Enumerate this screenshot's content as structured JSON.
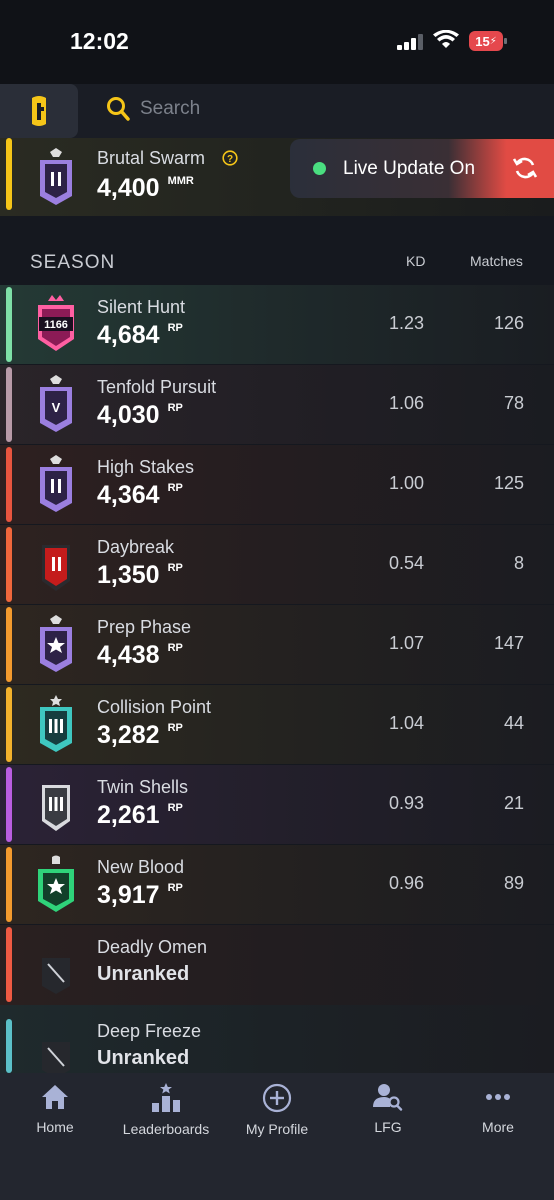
{
  "status_bar": {
    "time": "12:02",
    "battery": "15"
  },
  "search": {
    "placeholder": "Search"
  },
  "ranked": {
    "name": "Brutal Swarm",
    "value": "4,400",
    "unit": "MMR"
  },
  "live_update": {
    "label": "Live Update On"
  },
  "season": {
    "title": "SEASON",
    "columns": {
      "kd": "KD",
      "matches": "Matches"
    },
    "rows": [
      {
        "name": "Silent Hunt",
        "value": "4,684",
        "unit": "RP",
        "kd": "1.23",
        "matches": "126"
      },
      {
        "name": "Tenfold Pursuit",
        "value": "4,030",
        "unit": "RP",
        "kd": "1.06",
        "matches": "78"
      },
      {
        "name": "High Stakes",
        "value": "4,364",
        "unit": "RP",
        "kd": "1.00",
        "matches": "125"
      },
      {
        "name": "Daybreak",
        "value": "1,350",
        "unit": "RP",
        "kd": "0.54",
        "matches": "8"
      },
      {
        "name": "Prep Phase",
        "value": "4,438",
        "unit": "RP",
        "kd": "1.07",
        "matches": "147"
      },
      {
        "name": "Collision Point",
        "value": "3,282",
        "unit": "RP",
        "kd": "1.04",
        "matches": "44"
      },
      {
        "name": "Twin Shells",
        "value": "2,261",
        "unit": "RP",
        "kd": "0.93",
        "matches": "21"
      },
      {
        "name": "New Blood",
        "value": "3,917",
        "unit": "RP",
        "kd": "0.96",
        "matches": "89"
      },
      {
        "name": "Deadly Omen",
        "status": "Unranked"
      },
      {
        "name": "Deep Freeze",
        "status": "Unranked"
      }
    ]
  },
  "rank_badges": {
    "silent_hunt": "1166"
  },
  "nav": {
    "home": "Home",
    "leaderboards": "Leaderboards",
    "my_profile": "My Profile",
    "lfg": "LFG",
    "more": "More"
  },
  "colors": {
    "accent_yellow": "#f5c518",
    "live_green": "#4ade80",
    "live_red": "#e14b44",
    "row_accents": [
      "#7ee0a7",
      "#b89aa8",
      "#e8553f",
      "#f0673c",
      "#f39a2e",
      "#f2b22c",
      "#b95ee0",
      "#f39a2e",
      "#ef5a43",
      "#5bc0c8"
    ]
  }
}
